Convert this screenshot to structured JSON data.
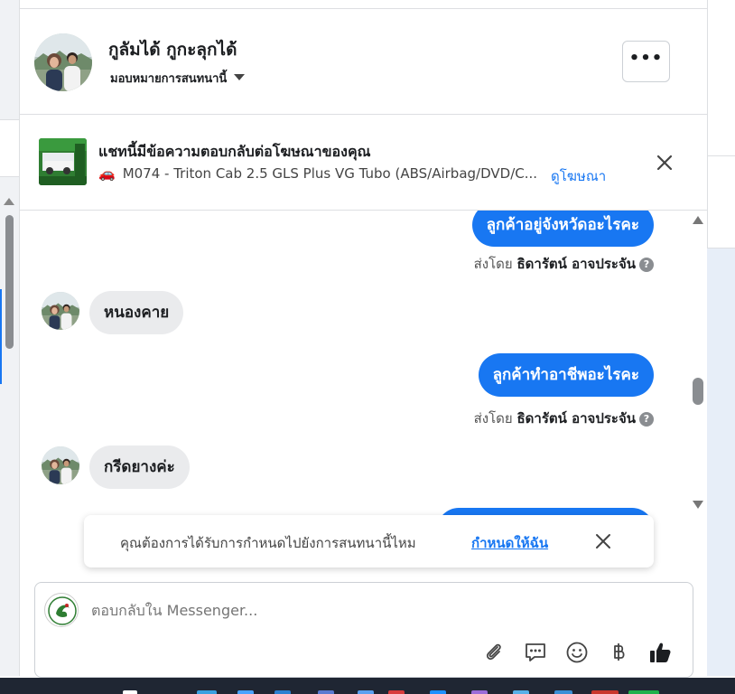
{
  "header": {
    "name": "กูลัมได้ กูกะลุกได้",
    "assign_label": "มอบหมายการสนทนานี้",
    "more_label": "•••"
  },
  "ad": {
    "title": "แชทนี้มีข้อความตอบกลับต่อโฆษณาของคุณ",
    "car_icon": "🚗",
    "subtitle": "M074 - Triton Cab 2.5 GLS Plus VG Tubo (ABS/Airbag/DVD/C...",
    "view_ad": "ดูโฆษณา"
  },
  "messages": [
    {
      "dir": "out",
      "text": "ลูกค้าอยู่จังหวัดอะไรคะ"
    },
    {
      "dir": "sent_by",
      "prefix": "ส่งโดย",
      "name": "ธิดารัตน์ อาจประจัน"
    },
    {
      "dir": "in",
      "text": "หนองคาย"
    },
    {
      "dir": "out",
      "text": "ลูกค้าทำอาชีพอะไรคะ"
    },
    {
      "dir": "sent_by",
      "prefix": "ส่งโดย",
      "name": "ธิดารัตน์ อาจประจัน"
    },
    {
      "dir": "in",
      "text": "กรีดยางค่ะ"
    }
  ],
  "toast": {
    "text": "คุณต้องการได้รับการกำหนดไปยังการสนทนานี้ไหม",
    "link": "กำหนดให้ฉัน"
  },
  "composer": {
    "placeholder": "ตอบกลับใน Messenger..."
  },
  "colors": {
    "accent": "#1877f2",
    "incoming_bubble": "#eaebed"
  }
}
